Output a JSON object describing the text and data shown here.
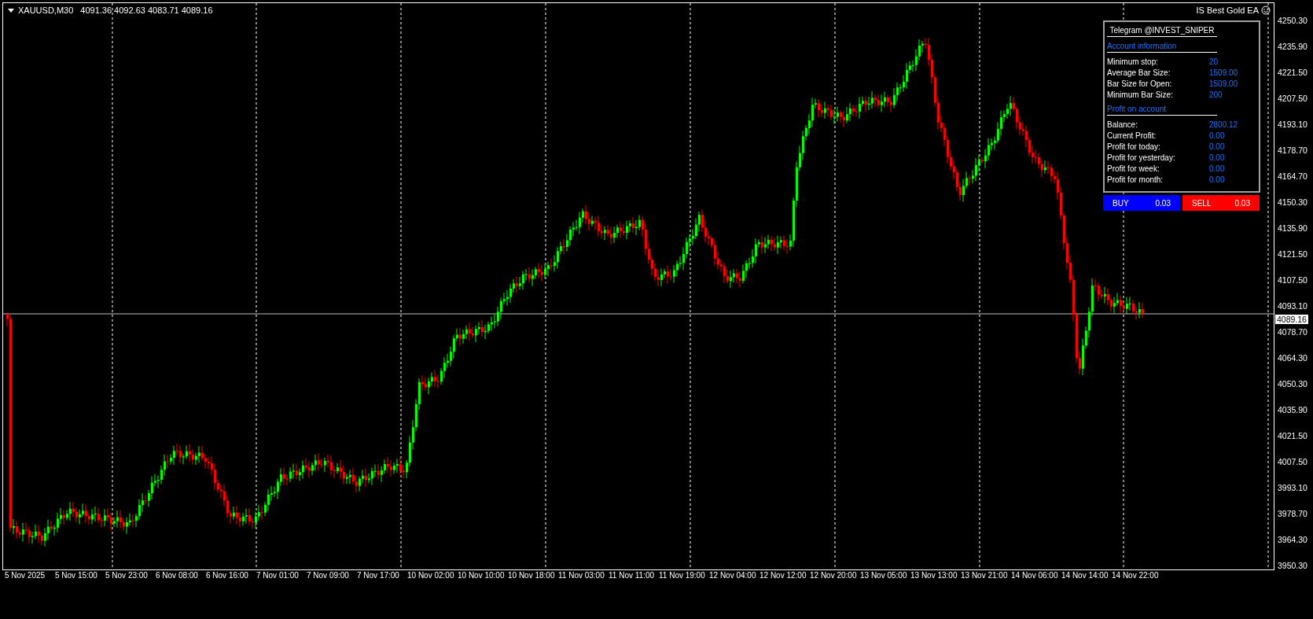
{
  "chart_header": {
    "symbol": "XAUUSD,M30",
    "ohlc": "4091.36 4092.63 4083.71 4089.16"
  },
  "ea_label": "IS Best Gold EA",
  "panel": {
    "title": "Telegram @INVEST_SNIPER",
    "sections": [
      {
        "heading": "Account information",
        "rows": [
          {
            "label": "Minimum stop:",
            "value": "20"
          },
          {
            "label": "Average Bar Size:",
            "value": "1509.00"
          },
          {
            "label": "Bar Size for Open:",
            "value": "1509.00"
          },
          {
            "label": "Minimum Bar Size:",
            "value": "200"
          }
        ]
      },
      {
        "heading": "Profit on account",
        "rows": [
          {
            "label": "Balance:",
            "value": "2800.12"
          },
          {
            "label": "Current Profit:",
            "value": "0.00"
          },
          {
            "label": "Profit for today:",
            "value": "0.00"
          },
          {
            "label": "Profit for yesterday:",
            "value": "0.00"
          },
          {
            "label": "Profit for week:",
            "value": "0.00"
          },
          {
            "label": "Profit for month:",
            "value": "0.00"
          }
        ]
      }
    ],
    "buttons": [
      {
        "kind": "buy",
        "label": "BUY",
        "lot": "0.03"
      },
      {
        "kind": "sell",
        "label": "SELL",
        "lot": "0.03"
      }
    ]
  },
  "price_axis": [
    "4250.30",
    "4235.90",
    "4221.50",
    "4207.50",
    "4193.10",
    "4178.70",
    "4164.70",
    "4150.30",
    "4135.90",
    "4121.50",
    "4107.50",
    "4093.10",
    "4078.70",
    "4064.30",
    "4050.30",
    "4035.90",
    "4021.50",
    "4007.50",
    "3993.10",
    "3978.70",
    "3964.30",
    "3950.30"
  ],
  "current_price": "4089.16",
  "time_axis": [
    "5 Nov 2025",
    "5 Nov 15:00",
    "5 Nov 23:00",
    "6 Nov 08:00",
    "6 Nov 16:00",
    "7 Nov 01:00",
    "7 Nov 09:00",
    "7 Nov 17:00",
    "10 Nov 02:00",
    "10 Nov 10:00",
    "10 Nov 18:00",
    "11 Nov 03:00",
    "11 Nov 11:00",
    "11 Nov 19:00",
    "12 Nov 04:00",
    "12 Nov 12:00",
    "12 Nov 20:00",
    "13 Nov 05:00",
    "13 Nov 13:00",
    "13 Nov 21:00",
    "14 Nov 06:00",
    "14 Nov 14:00",
    "14 Nov 22:00"
  ]
}
